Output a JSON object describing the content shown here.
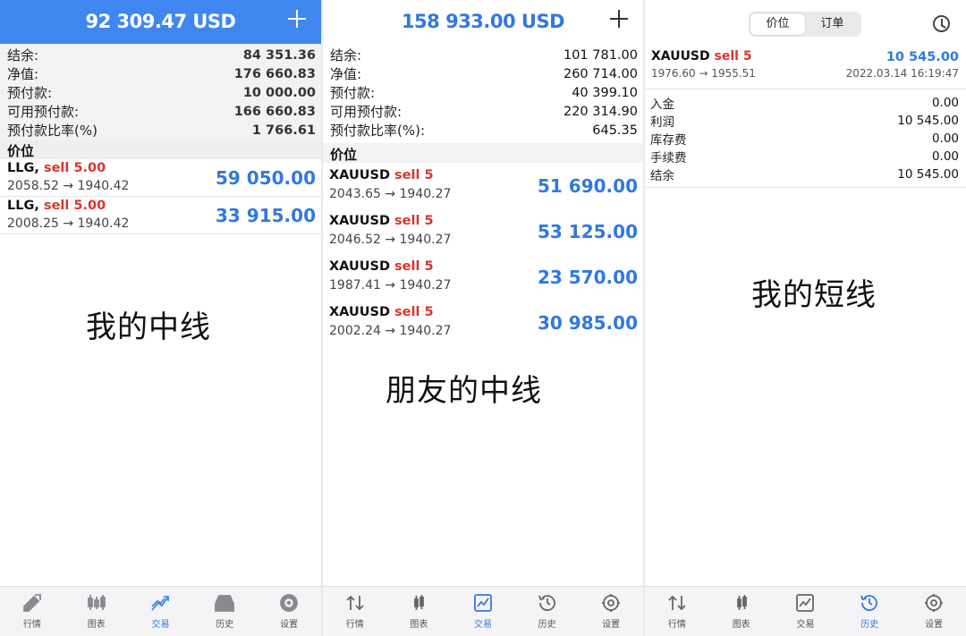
{
  "colors": {
    "accent": "#3f86f0",
    "profit_blue": "#3178e0",
    "sell_red": "#d8352a"
  },
  "panel1": {
    "header": {
      "title": "92 309.47 USD",
      "plus_icon": "plus-icon"
    },
    "summary": [
      {
        "label": "结余:",
        "value": "84 351.36"
      },
      {
        "label": "净值:",
        "value": "176 660.83"
      },
      {
        "label": "预付款:",
        "value": "10 000.00"
      },
      {
        "label": "可用预付款:",
        "value": "166 660.83"
      },
      {
        "label": "预付款比率(%)",
        "value": "1 766.61"
      }
    ],
    "section_label": "价位",
    "positions": [
      {
        "symbol": "LLG,",
        "side": " sell 5.00",
        "prices": "2058.52 → 1940.42",
        "profit": "59 050.00"
      },
      {
        "symbol": "LLG,",
        "side": " sell 5.00",
        "prices": "2008.25 → 1940.42",
        "profit": "33 915.00"
      }
    ],
    "caption": "我的中线",
    "tabs": [
      {
        "label": "行情",
        "icon": "quotes-icon"
      },
      {
        "label": "图表",
        "icon": "candlestick-icon"
      },
      {
        "label": "交易",
        "icon": "trade-icon"
      },
      {
        "label": "历史",
        "icon": "inbox-icon"
      },
      {
        "label": "设置",
        "icon": "gear-icon"
      }
    ]
  },
  "panel2": {
    "header": {
      "title": "158 933.00 USD",
      "plus_icon": "plus-icon"
    },
    "summary": [
      {
        "label": "结余:",
        "value": "101 781.00"
      },
      {
        "label": "净值:",
        "value": "260 714.00"
      },
      {
        "label": "预付款:",
        "value": "40 399.10"
      },
      {
        "label": "可用预付款:",
        "value": "220 314.90"
      },
      {
        "label": "预付款比率(%):",
        "value": "645.35"
      }
    ],
    "section_label": "价位",
    "positions": [
      {
        "symbol": "XAUUSD",
        "side": " sell 5",
        "prices": "2043.65 → 1940.27",
        "profit": "51 690.00"
      },
      {
        "symbol": "XAUUSD",
        "side": " sell 5",
        "prices": "2046.52 → 1940.27",
        "profit": "53 125.00"
      },
      {
        "symbol": "XAUUSD",
        "side": " sell 5",
        "prices": "1987.41 → 1940.27",
        "profit": "23 570.00"
      },
      {
        "symbol": "XAUUSD",
        "side": " sell 5",
        "prices": "2002.24 → 1940.27",
        "profit": "30 985.00"
      }
    ],
    "caption": "朋友的中线",
    "tabs": [
      {
        "label": "行情",
        "icon": "quotes-icon"
      },
      {
        "label": "图表",
        "icon": "candlestick-icon"
      },
      {
        "label": "交易",
        "icon": "trade-icon"
      },
      {
        "label": "历史",
        "icon": "clock-icon"
      },
      {
        "label": "设置",
        "icon": "gear-icon"
      }
    ]
  },
  "panel3": {
    "segment": {
      "tab1": "价位",
      "tab2": "订单"
    },
    "deal": {
      "symbol": "XAUUSD",
      "side": " sell 5",
      "prices": "1976.60 → 1955.51",
      "profit": "10 545.00",
      "time": "2022.03.14 16:19:47"
    },
    "summary": [
      {
        "label": "入金",
        "value": "0.00"
      },
      {
        "label": "利润",
        "value": "10 545.00"
      },
      {
        "label": "库存费",
        "value": "0.00"
      },
      {
        "label": "手续费",
        "value": "0.00"
      },
      {
        "label": "结余",
        "value": "10 545.00"
      }
    ],
    "caption": "我的短线",
    "tabs": [
      {
        "label": "行情",
        "icon": "quotes-icon"
      },
      {
        "label": "图表",
        "icon": "candlestick-icon"
      },
      {
        "label": "交易",
        "icon": "trade-icon"
      },
      {
        "label": "历史",
        "icon": "clock-icon"
      },
      {
        "label": "设置",
        "icon": "gear-icon"
      }
    ]
  }
}
